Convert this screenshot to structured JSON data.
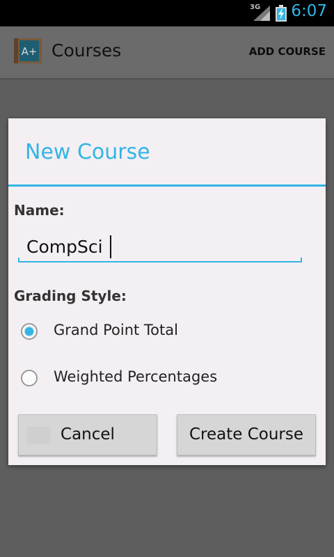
{
  "status_bar": {
    "network": "3G",
    "time": "6:07",
    "signal_icon": "signal-bars-icon",
    "battery_icon": "battery-charging-icon"
  },
  "action_bar": {
    "title": "Courses",
    "app_icon": "grade-a-plus-book-icon",
    "add_course_label": "ADD COURSE"
  },
  "dialog": {
    "title": "New Course",
    "name_label": "Name:",
    "name_value": "CompSci",
    "grading_label": "Grading Style:",
    "options": [
      {
        "label": "Grand Point Total",
        "checked": true
      },
      {
        "label": "Weighted Percentages",
        "checked": false
      }
    ],
    "cancel_label": "Cancel",
    "create_label": "Create Course"
  },
  "colors": {
    "accent": "#33b5e5",
    "dialog_bg": "#f3eff3",
    "scrim": "#5e5e5e"
  }
}
